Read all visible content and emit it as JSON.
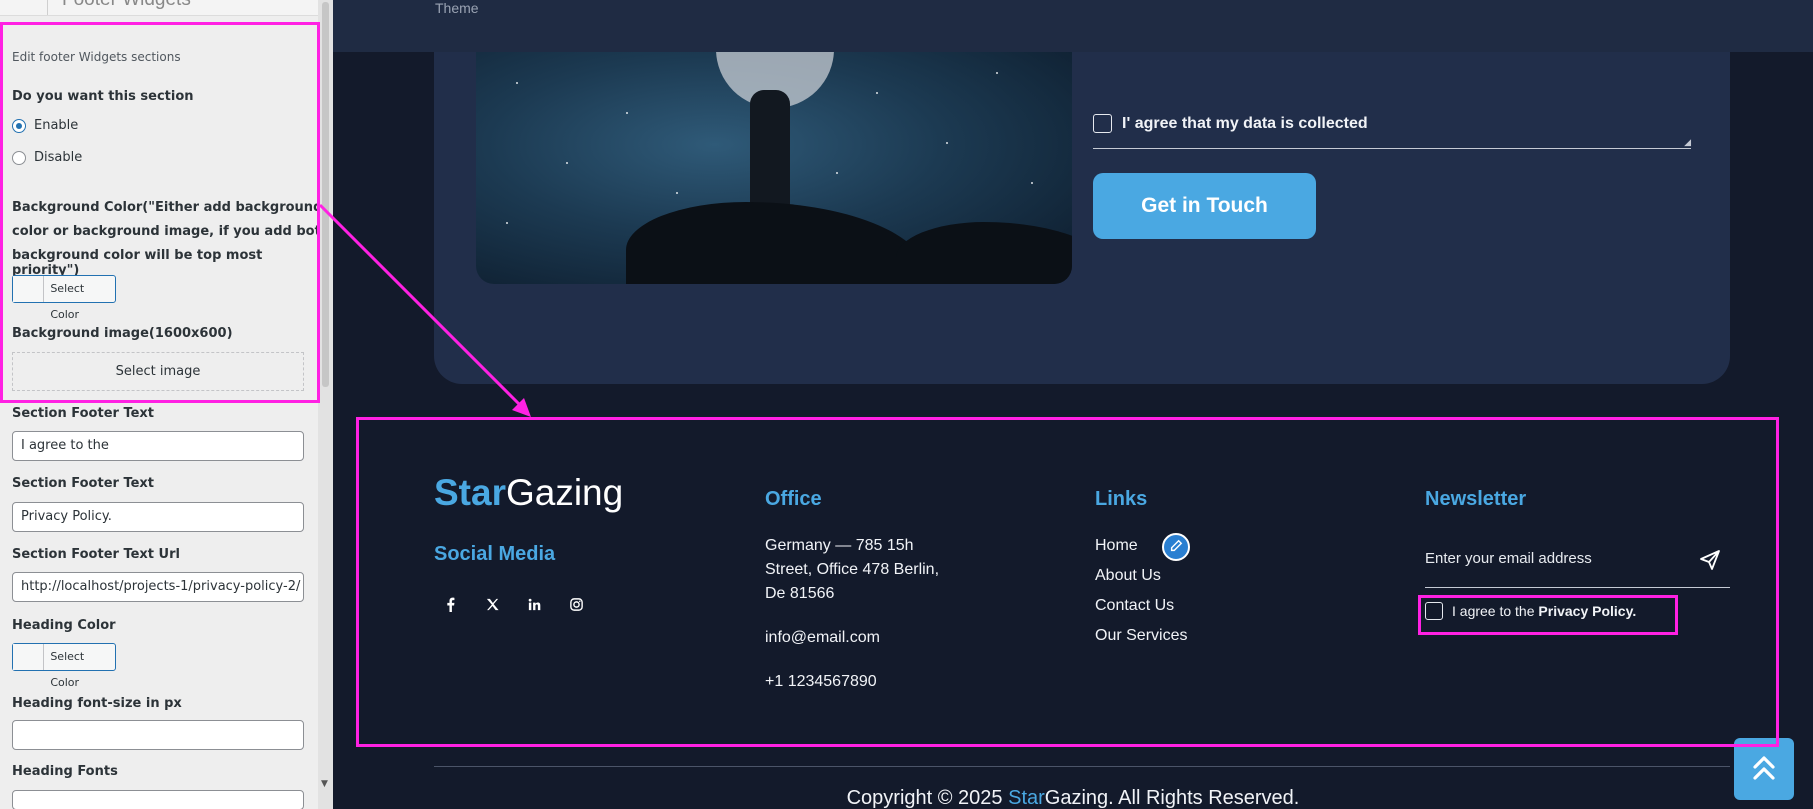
{
  "sidebar": {
    "panel_title": "Footer Widgets",
    "section_desc": "Edit footer Widgets sections",
    "enable_question": "Do you want this section",
    "enable_label": "Enable",
    "disable_label": "Disable",
    "enabled": true,
    "bg_color_label_1": "Background Color(\"Either add background",
    "bg_color_label_2": "color or background image, if you add both",
    "bg_color_label_3": "background color will be top most priority\")",
    "select_color": "Select Color",
    "bg_image_label": "Background image(1600x600)",
    "select_image": "Select image",
    "footer_text_label_1": "Section Footer Text",
    "footer_text_value_1": "I agree to the",
    "footer_text_label_2": "Section Footer Text",
    "footer_text_value_2": "Privacy Policy.",
    "footer_url_label": "Section Footer Text Url",
    "footer_url_value": "http://localhost/projects-1/privacy-policy-2/",
    "heading_color_label": "Heading Color",
    "heading_size_label": "Heading font-size in px",
    "heading_size_value": "",
    "heading_fonts_label": "Heading Fonts"
  },
  "preview": {
    "top_text": "Theme",
    "consent_text": "I' agree that my data is collected",
    "cta_label": "Get in Touch",
    "brand_part1": "Star",
    "brand_part2": "Gazing",
    "social_title": "Social Media",
    "social_icons": [
      "facebook-icon",
      "x-twitter-icon",
      "linkedin-icon",
      "instagram-icon"
    ],
    "office_title": "Office",
    "office_line1": "Germany — 785 15h",
    "office_line2": "Street, Office 478 Berlin,",
    "office_line3": "De 81566",
    "office_email": "info@email.com",
    "office_phone": "+1 1234567890",
    "links_title": "Links",
    "links": [
      "Home",
      "About Us",
      "Contact Us",
      "Our Services"
    ],
    "newsletter_title": "Newsletter",
    "newsletter_placeholder": "Enter your email address",
    "privacy_prefix": "I agree to the",
    "privacy_link": "Privacy Policy.",
    "copyright_prefix": "Copyright © 2025",
    "copyright_brand1": "Star",
    "copyright_brand2": "Gazing",
    "copyright_suffix": ". All Rights Reserved."
  },
  "colors": {
    "accent": "#4aa8e2",
    "footer_bg": "#131a2b",
    "card_bg": "#212e4a",
    "annotation": "#ff21e3"
  }
}
